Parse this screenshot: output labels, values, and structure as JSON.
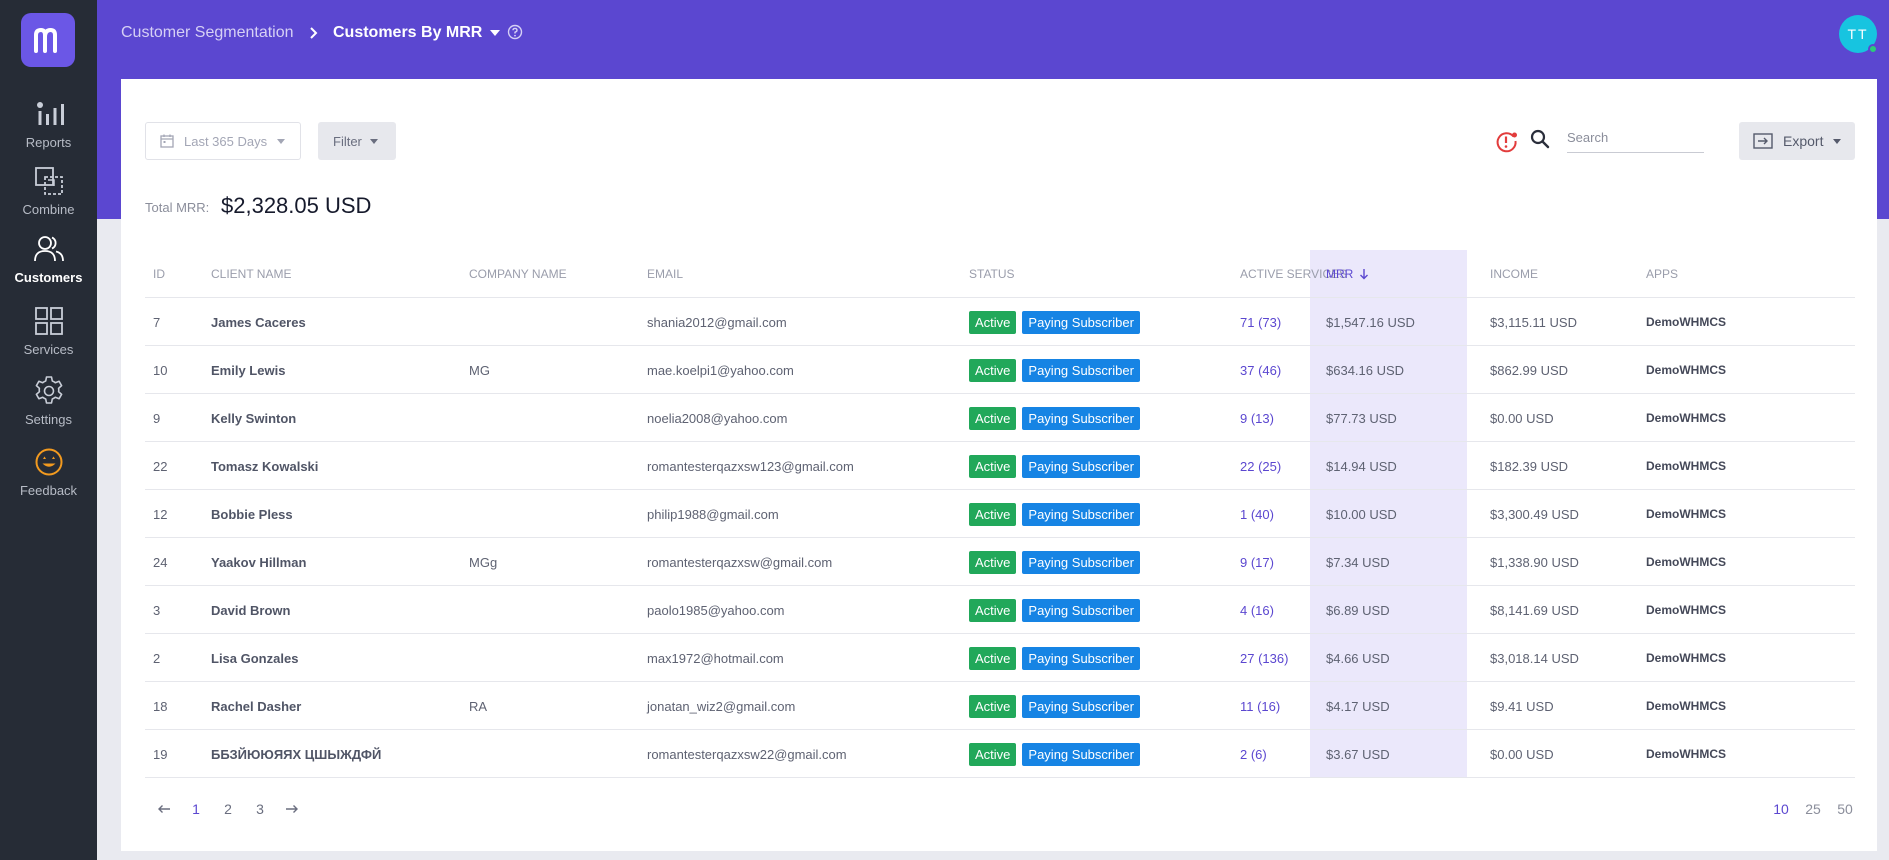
{
  "sidebar": {
    "items": [
      {
        "label": "Reports"
      },
      {
        "label": "Combine"
      },
      {
        "label": "Customers"
      },
      {
        "label": "Services"
      },
      {
        "label": "Settings"
      },
      {
        "label": "Feedback"
      }
    ]
  },
  "header": {
    "breadcrumb_parent": "Customer Segmentation",
    "breadcrumb_current": "Customers By MRR",
    "avatar_initials": "TT"
  },
  "toolbar": {
    "date_range": "Last 365 Days",
    "filter_label": "Filter",
    "search_placeholder": "Search",
    "export_label": "Export"
  },
  "summary": {
    "label": "Total MRR:",
    "value": "$2,328.05 USD"
  },
  "table": {
    "columns": {
      "id": "ID",
      "client": "CLIENT NAME",
      "company": "COMPANY NAME",
      "email": "EMAIL",
      "status": "STATUS",
      "services": "ACTIVE SERVICES",
      "mrr": "MRR",
      "income": "INCOME",
      "apps": "APPS"
    },
    "status_active": "Active",
    "status_paying": "Paying Subscriber",
    "rows": [
      {
        "id": "7",
        "client": "James Caceres",
        "company": "",
        "email": "shania2012@gmail.com",
        "services": "71 (73)",
        "mrr": "$1,547.16 USD",
        "income": "$3,115.11 USD",
        "apps": "DemoWHMCS"
      },
      {
        "id": "10",
        "client": "Emily Lewis",
        "company": "MG",
        "email": "mae.koelpi1@yahoo.com",
        "services": "37 (46)",
        "mrr": "$634.16 USD",
        "income": "$862.99 USD",
        "apps": "DemoWHMCS"
      },
      {
        "id": "9",
        "client": "Kelly Swinton",
        "company": "",
        "email": "noelia2008@yahoo.com",
        "services": "9 (13)",
        "mrr": "$77.73 USD",
        "income": "$0.00 USD",
        "apps": "DemoWHMCS"
      },
      {
        "id": "22",
        "client": "Tomasz Kowalski",
        "company": "",
        "email": "romantesterqazxsw123@gmail.com",
        "services": "22 (25)",
        "mrr": "$14.94 USD",
        "income": "$182.39 USD",
        "apps": "DemoWHMCS"
      },
      {
        "id": "12",
        "client": "Bobbie Pless",
        "company": "",
        "email": "philip1988@gmail.com",
        "services": "1 (40)",
        "mrr": "$10.00 USD",
        "income": "$3,300.49 USD",
        "apps": "DemoWHMCS"
      },
      {
        "id": "24",
        "client": "Yaakov Hillman",
        "company": "MGg",
        "email": "romantesterqazxsw@gmail.com",
        "services": "9 (17)",
        "mrr": "$7.34 USD",
        "income": "$1,338.90 USD",
        "apps": "DemoWHMCS"
      },
      {
        "id": "3",
        "client": "David Brown",
        "company": "",
        "email": "paolo1985@yahoo.com",
        "services": "4 (16)",
        "mrr": "$6.89 USD",
        "income": "$8,141.69 USD",
        "apps": "DemoWHMCS"
      },
      {
        "id": "2",
        "client": "Lisa Gonzales",
        "company": "",
        "email": "max1972@hotmail.com",
        "services": "27 (136)",
        "mrr": "$4.66 USD",
        "income": "$3,018.14 USD",
        "apps": "DemoWHMCS"
      },
      {
        "id": "18",
        "client": "Rachel Dasher",
        "company": "RA",
        "email": "jonatan_wiz2@gmail.com",
        "services": "11 (16)",
        "mrr": "$4.17 USD",
        "income": "$9.41 USD",
        "apps": "DemoWHMCS"
      },
      {
        "id": "19",
        "client": "ББЗЙЮЮЯЯХ ЦШЫЖДФЙ",
        "company": "",
        "email": "romantesterqazxsw22@gmail.com",
        "services": "2 (6)",
        "mrr": "$3.67 USD",
        "income": "$0.00 USD",
        "apps": "DemoWHMCS"
      }
    ]
  },
  "pagination": {
    "pages": [
      "1",
      "2",
      "3"
    ],
    "page_sizes": [
      "10",
      "25",
      "50"
    ]
  },
  "colors": {
    "sidebar_bg": "#262c36",
    "header_bg": "#5b47d0",
    "accent": "#5b47d0",
    "active_badge": "#21a85a",
    "paying_badge": "#1684e4",
    "mrr_column_bg": "#ebe8fb"
  }
}
